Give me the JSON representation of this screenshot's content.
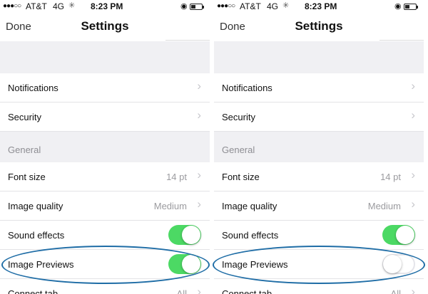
{
  "panels": [
    {
      "status": {
        "signal": "●●●○○",
        "carrier": "AT&T",
        "network": "4G",
        "activity": "✳",
        "time": "8:23 PM",
        "lock": "◉",
        "battery_level": 0.4
      },
      "nav": {
        "done_label": "Done",
        "title": "Settings"
      },
      "rows": {
        "notifications": {
          "label": "Notifications",
          "chevron": "›"
        },
        "security": {
          "label": "Security",
          "chevron": "›"
        },
        "general_header": "General",
        "font_size": {
          "label": "Font size",
          "value": "14 pt",
          "chevron": "›"
        },
        "image_quality": {
          "label": "Image quality",
          "value": "Medium",
          "chevron": "›"
        },
        "sound_effects": {
          "label": "Sound effects",
          "toggle": "on"
        },
        "image_previews": {
          "label": "Image Previews",
          "toggle": "on"
        },
        "connect_tab": {
          "label": "Connect tab",
          "value": "All",
          "chevron": "›"
        }
      }
    },
    {
      "status": {
        "signal": "●●●○○",
        "carrier": "AT&T",
        "network": "4G",
        "activity": "✳",
        "time": "8:23 PM",
        "lock": "◉",
        "battery_level": 0.4
      },
      "nav": {
        "done_label": "Done",
        "title": "Settings"
      },
      "rows": {
        "notifications": {
          "label": "Notifications",
          "chevron": "›"
        },
        "security": {
          "label": "Security",
          "chevron": "›"
        },
        "general_header": "General",
        "font_size": {
          "label": "Font size",
          "value": "14 pt",
          "chevron": "›"
        },
        "image_quality": {
          "label": "Image quality",
          "value": "Medium",
          "chevron": "›"
        },
        "sound_effects": {
          "label": "Sound effects",
          "toggle": "on"
        },
        "image_previews": {
          "label": "Image Previews",
          "toggle": "off"
        },
        "connect_tab": {
          "label": "Connect tab",
          "value": "All",
          "chevron": "›"
        }
      }
    }
  ],
  "colors": {
    "toggle_on": "#4cd964",
    "annotation_oval": "#1f6da6",
    "section_header": "#8e8e93"
  }
}
